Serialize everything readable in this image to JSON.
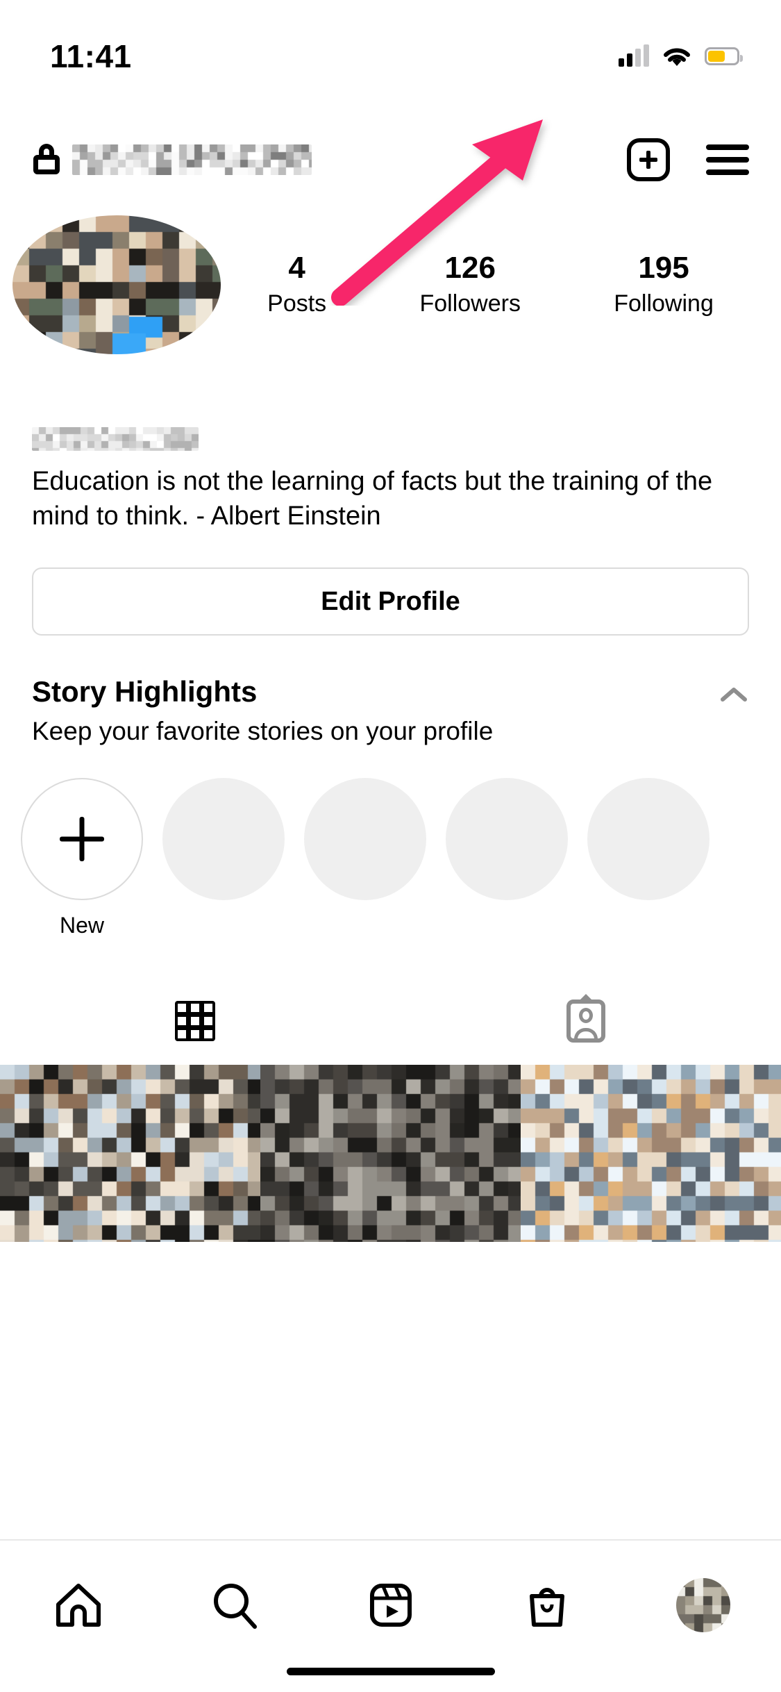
{
  "status_bar": {
    "time": "11:41",
    "cellular_icon": "cellular-signal-icon",
    "wifi_icon": "wifi-icon",
    "battery_icon": "battery-low-power-icon",
    "battery_color": "#fcc300"
  },
  "header": {
    "private_icon": "lock-icon",
    "username": "",
    "username_redacted": true,
    "new_post_label": "+",
    "new_post_icon": "plus-square-icon",
    "menu_icon": "hamburger-menu-icon"
  },
  "profile": {
    "avatar_redacted": true,
    "display_name": "",
    "display_name_redacted": true,
    "bio": "Education is not the learning of facts but the training of the mind to think. - Albert Einstein",
    "stats": [
      {
        "value": "4",
        "label": "Posts"
      },
      {
        "value": "126",
        "label": "Followers"
      },
      {
        "value": "195",
        "label": "Following"
      }
    ],
    "edit_profile_label": "Edit Profile"
  },
  "story_highlights": {
    "title": "Story Highlights",
    "subtitle": "Keep your favorite stories on your profile",
    "collapse_icon": "chevron-up-icon",
    "items": [
      {
        "label": "New",
        "type": "new",
        "icon": "plus-icon"
      },
      {
        "label": "",
        "type": "placeholder"
      },
      {
        "label": "",
        "type": "placeholder"
      },
      {
        "label": "",
        "type": "placeholder"
      },
      {
        "label": "",
        "type": "placeholder"
      }
    ]
  },
  "tabs": [
    {
      "name": "grid",
      "icon": "grid-icon",
      "active": true
    },
    {
      "name": "tagged",
      "icon": "tagged-person-icon",
      "active": false
    }
  ],
  "post_grid": {
    "rows": 1,
    "columns": 3,
    "cells_redacted": true
  },
  "bottom_nav": [
    {
      "name": "home",
      "icon": "home-icon"
    },
    {
      "name": "search",
      "icon": "search-icon"
    },
    {
      "name": "reels",
      "icon": "reels-icon"
    },
    {
      "name": "shop",
      "icon": "shopping-bag-icon"
    },
    {
      "name": "profile",
      "icon": "profile-avatar-icon"
    }
  ],
  "annotation": {
    "type": "arrow",
    "color": "#f7286a",
    "points_to": "hamburger-menu-icon"
  }
}
